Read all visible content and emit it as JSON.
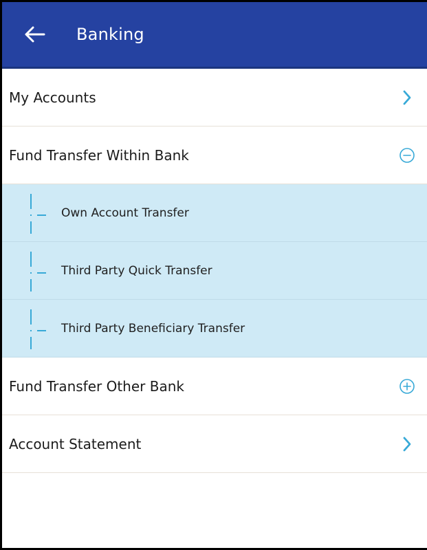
{
  "header": {
    "title": "Banking",
    "back_icon": "arrow-left-icon",
    "background": "#2542a1"
  },
  "menu": {
    "items": [
      {
        "label": "My Accounts",
        "icon": "chevron-right-icon"
      },
      {
        "label": "Fund Transfer Within Bank",
        "icon": "minus-circle-icon",
        "expanded": true
      },
      {
        "label": "Fund Transfer Other Bank",
        "icon": "plus-circle-icon"
      },
      {
        "label": "Account Statement",
        "icon": "chevron-right-icon"
      }
    ],
    "sub_items": [
      {
        "label": "Own Account Transfer"
      },
      {
        "label": "Third Party Quick Transfer"
      },
      {
        "label": "Third Party Beneficiary Transfer"
      }
    ]
  },
  "colors": {
    "accent": "#37a9d7",
    "sub_bg": "#cfeaf6"
  }
}
